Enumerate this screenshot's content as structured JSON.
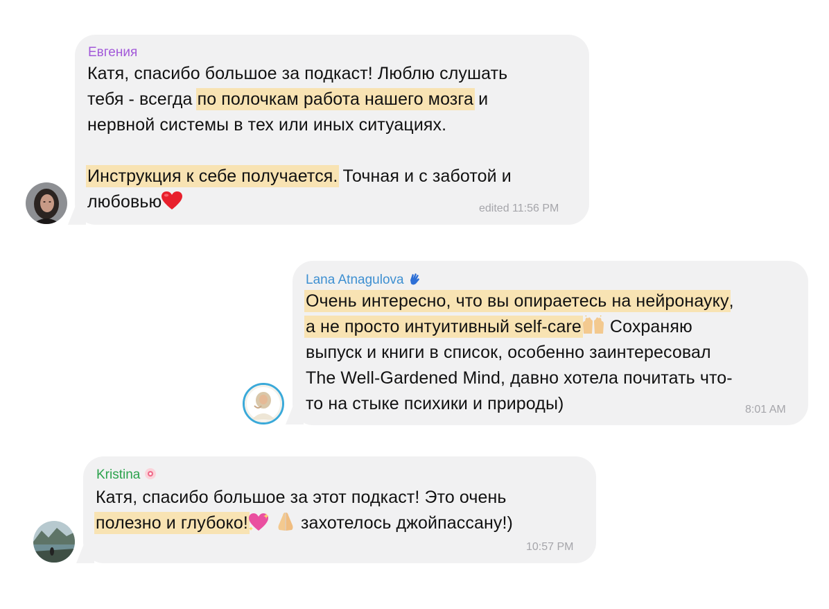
{
  "messages": [
    {
      "sender": "Евгения",
      "sender_color": "#a259d9",
      "lines": [
        [
          {
            "t": "Катя, спасибо большое за подкаст! Люблю слушать"
          }
        ],
        [
          {
            "t": "тебя - всегда "
          },
          {
            "t": "по полочкам работа нашего мозга",
            "hl": true
          },
          {
            "t": " и"
          }
        ],
        [
          {
            "t": "нервной системы в тех или иных ситуациях."
          }
        ],
        [
          {
            "t": ""
          }
        ],
        [
          {
            "t": "Инструкция к себе получается.",
            "hl": true
          },
          {
            "t": " Точная и с заботой и"
          }
        ],
        [
          {
            "t": "любовью"
          },
          {
            "icon": "red-heart-emoji"
          }
        ]
      ],
      "time": "edited 11:56 PM",
      "avatar_icon": "woman-portrait-avatar"
    },
    {
      "sender": "Lana Atnagulova",
      "sender_color": "#3d8fd1",
      "sender_badge_icon": "waving-hand-emoji",
      "lines": [
        [
          {
            "t": "Очень интересно, что вы опираетесь на нейронауку",
            "hl": true
          },
          {
            "t": ","
          }
        ],
        [
          {
            "t": "а не просто интуитивный self-care",
            "hl": true
          },
          {
            "icon": "raising-hands-emoji"
          },
          {
            "t": " Сохраняю"
          }
        ],
        [
          {
            "t": "выпуск и книги в список, особенно заинтересовал"
          }
        ],
        [
          {
            "t": "The Well-Gardened Mind, давно хотела почитать что-"
          }
        ],
        [
          {
            "t": "то на стыке психики и природы)"
          }
        ]
      ],
      "time": "8:01 AM",
      "avatar_icon": "woman-outdoors-avatar"
    },
    {
      "sender": "Kristina",
      "sender_color": "#2ba24c",
      "sender_badge_icon": "pink-sparkle-emoji",
      "lines": [
        [
          {
            "t": "Катя, спасибо большое за этот подкаст! Это очень"
          }
        ],
        [
          {
            "t": "полезно и глубоко!",
            "hl": true
          },
          {
            "icon": "sparkling-heart-emoji"
          },
          {
            "t": " "
          },
          {
            "icon": "folded-hands-emoji"
          },
          {
            "t": " захотелось  джойпассану!)"
          }
        ]
      ],
      "time": "10:57 PM",
      "avatar_icon": "lake-mountains-avatar"
    }
  ]
}
